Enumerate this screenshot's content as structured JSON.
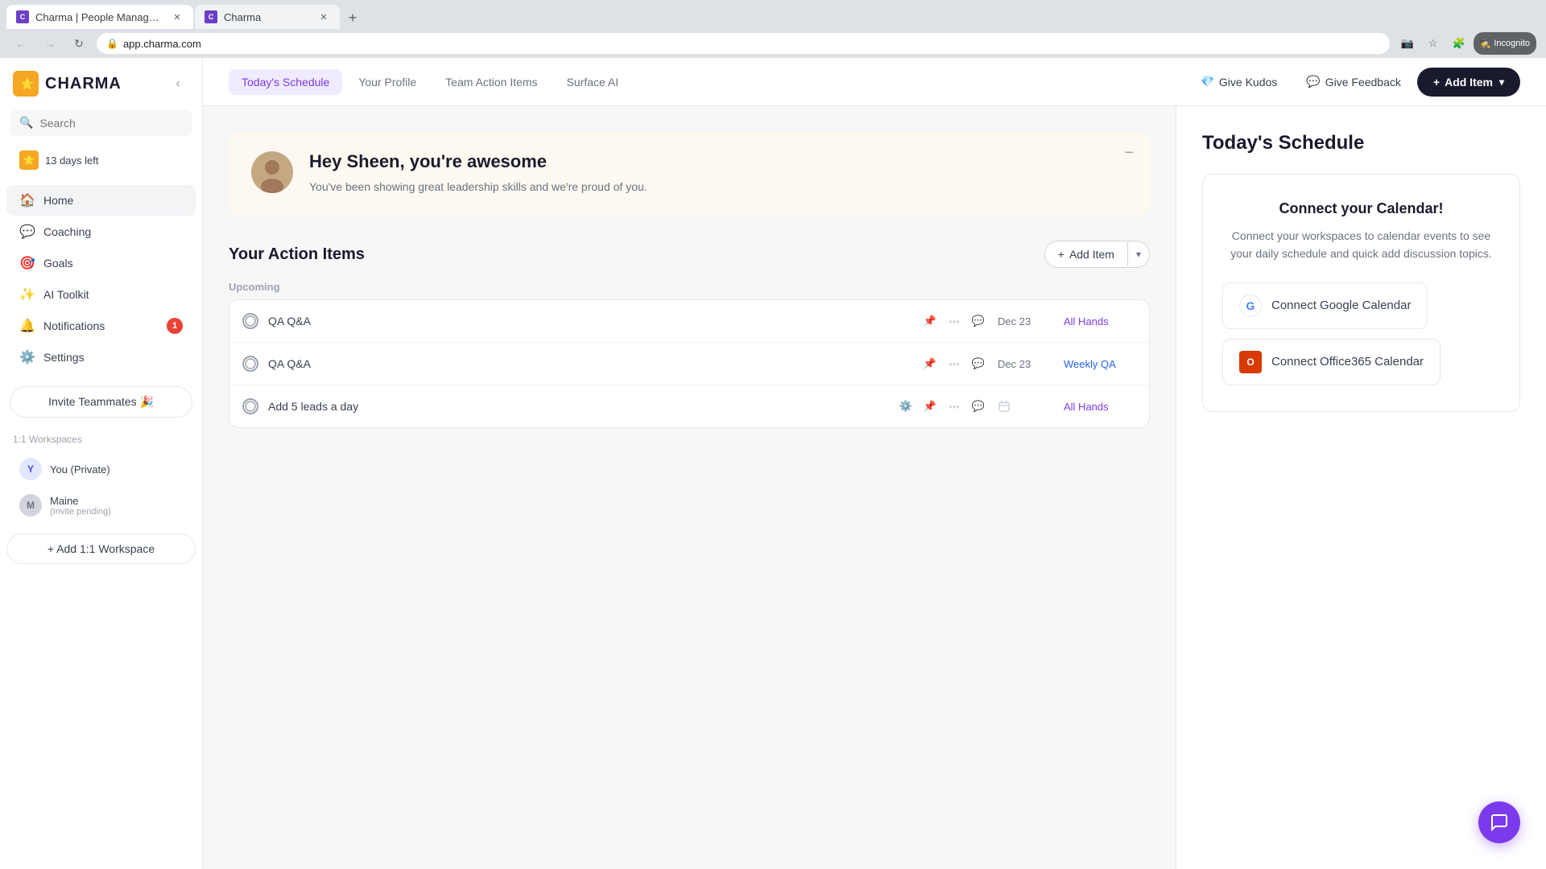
{
  "browser": {
    "tabs": [
      {
        "id": "tab1",
        "label": "Charma | People Management ...",
        "favicon_text": "C",
        "active": true
      },
      {
        "id": "tab2",
        "label": "Charma",
        "favicon_text": "C",
        "active": false
      }
    ],
    "new_tab_label": "+",
    "address_url": "app.charma.com",
    "incognito_label": "Incognito"
  },
  "sidebar": {
    "logo_text": "CHARMA",
    "search_placeholder": "Search",
    "days_left_label": "13 days left",
    "nav_items": [
      {
        "id": "home",
        "label": "Home",
        "icon": "🏠",
        "active": true
      },
      {
        "id": "coaching",
        "label": "Coaching",
        "icon": "💬",
        "active": false
      },
      {
        "id": "goals",
        "label": "Goals",
        "icon": "🎯",
        "active": false
      },
      {
        "id": "ai_toolkit",
        "label": "AI Toolkit",
        "icon": "✨",
        "active": false
      },
      {
        "id": "notifications",
        "label": "Notifications",
        "icon": "🔔",
        "badge": "1",
        "active": false
      },
      {
        "id": "settings",
        "label": "Settings",
        "icon": "⚙️",
        "active": false
      }
    ],
    "invite_btn_label": "Invite Teammates 🎉",
    "workspaces_label": "1:1 Workspaces",
    "workspaces": [
      {
        "id": "private",
        "name": "You (Private)",
        "avatar_text": "Y",
        "sub": ""
      },
      {
        "id": "maine",
        "name": "Maine",
        "avatar_text": "M",
        "sub": "(Invite pending)"
      }
    ],
    "add_workspace_label": "+ Add 1:1 Workspace"
  },
  "top_nav": {
    "tabs": [
      {
        "id": "schedule",
        "label": "Today's Schedule",
        "active": true
      },
      {
        "id": "profile",
        "label": "Your Profile",
        "active": false
      },
      {
        "id": "team_actions",
        "label": "Team Action Items",
        "active": false
      },
      {
        "id": "surface_ai",
        "label": "Surface AI",
        "active": false
      }
    ],
    "give_kudos_label": "Give Kudos",
    "give_kudos_icon": "💎",
    "give_feedback_label": "Give Feedback",
    "give_feedback_icon": "💬",
    "add_item_label": "Add Item",
    "add_item_icon": "+"
  },
  "welcome_card": {
    "title": "Hey Sheen, you're awesome",
    "text": "You've been showing great leadership skills and we're proud of you.",
    "avatar_emoji": "👤"
  },
  "action_items": {
    "section_title": "Your Action Items",
    "add_btn_label": "Add Item",
    "upcoming_label": "Upcoming",
    "rows": [
      {
        "id": "row1",
        "title": "QA Q&A",
        "date": "Dec 23",
        "tag": "All Hands",
        "tag_color": "purple"
      },
      {
        "id": "row2",
        "title": "QA Q&A",
        "date": "Dec 23",
        "tag": "Weekly QA",
        "tag_color": "blue"
      },
      {
        "id": "row3",
        "title": "Add 5 leads a day",
        "date": "",
        "tag": "All Hands",
        "tag_color": "purple",
        "has_gear": true
      }
    ]
  },
  "right_panel": {
    "title": "Today's Schedule",
    "calendar_box": {
      "title": "Connect your Calendar!",
      "description": "Connect your workspaces to calendar events to see your daily schedule and quick add discussion topics.",
      "google_btn_label": "Connect Google Calendar",
      "office365_btn_label": "Connect Office365 Calendar"
    }
  },
  "chat_fab": {
    "icon": "💬"
  }
}
